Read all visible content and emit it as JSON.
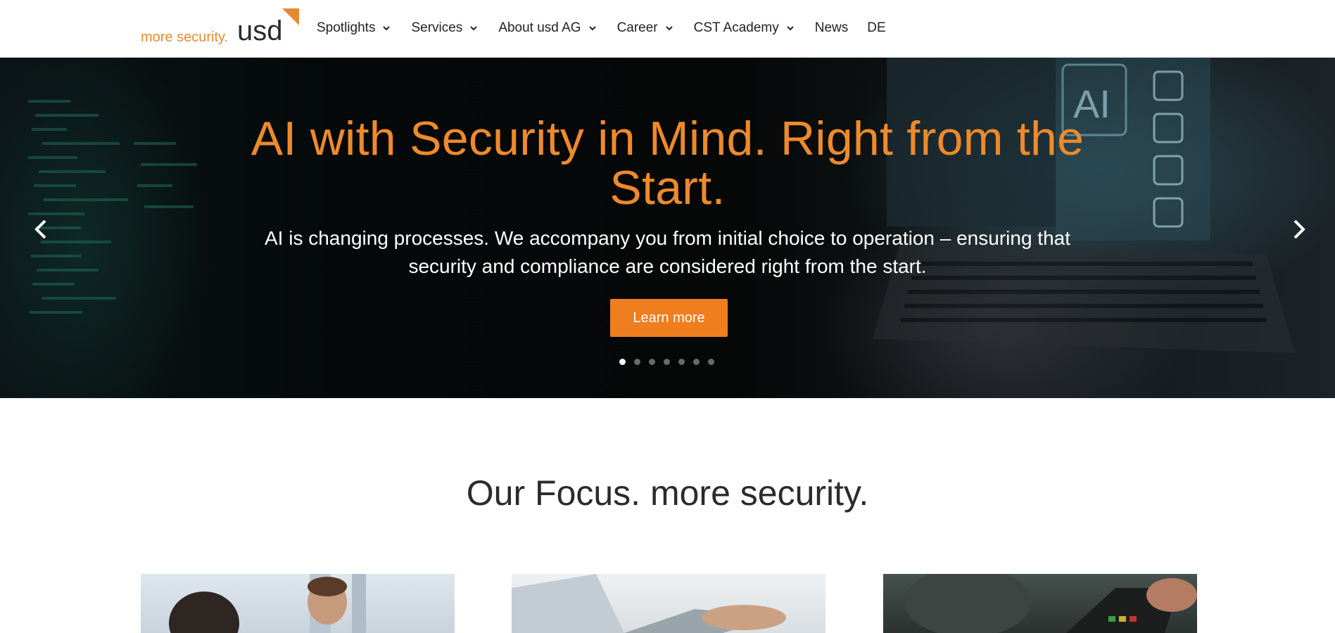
{
  "header": {
    "logo_tagline": "more security.",
    "logo_brand": "usd",
    "nav": [
      {
        "label": "Spotlights",
        "dropdown": true
      },
      {
        "label": "Services",
        "dropdown": true
      },
      {
        "label": "About usd AG",
        "dropdown": true
      },
      {
        "label": "Career",
        "dropdown": true
      },
      {
        "label": "CST Academy",
        "dropdown": true
      },
      {
        "label": "News",
        "dropdown": false
      },
      {
        "label": "DE",
        "dropdown": false
      }
    ]
  },
  "hero": {
    "title": "AI with Security in Mind. Right from the Start.",
    "subtitle": "AI is changing processes. We accompany you from initial choice to operation – ensuring that security and compliance are considered right from the start.",
    "button_label": "Learn more",
    "slide_count": 7,
    "active_slide": 1,
    "image_label": "AI"
  },
  "focus": {
    "title": "Our Focus. more security."
  },
  "colors": {
    "accent": "#ee7e1e",
    "title_orange": "#ee8a2b",
    "text_dark": "#2b2b2b"
  }
}
